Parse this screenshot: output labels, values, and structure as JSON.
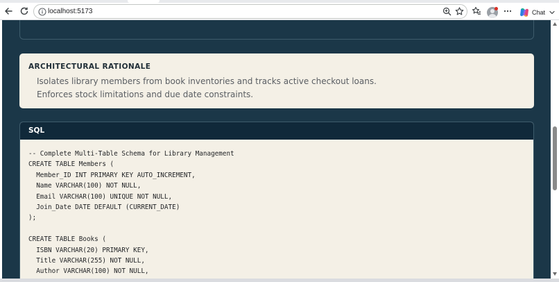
{
  "browser": {
    "url": "localhost:5173",
    "chat_label": "Chat",
    "icons": [
      "back-icon",
      "reload-icon",
      "info-icon",
      "zoom-icon",
      "star-icon",
      "favorites-icon",
      "profile-avatar",
      "more-icon",
      "copilot-icon",
      "chevron-down-icon"
    ]
  },
  "rationale": {
    "title": "ARCHITECTURAL RATIONALE",
    "lines": [
      "Isolates library members from book inventories and tracks active checkout loans.",
      "Enforces stock limitations and due date constraints."
    ]
  },
  "sql": {
    "title": "SQL",
    "lines": [
      "-- Complete Multi-Table Schema for Library Management",
      "CREATE TABLE Members (",
      "  Member_ID INT PRIMARY KEY AUTO_INCREMENT,",
      "  Name VARCHAR(100) NOT NULL,",
      "  Email VARCHAR(100) UNIQUE NOT NULL,",
      "  Join_Date DATE DEFAULT (CURRENT_DATE)",
      ");",
      "",
      "CREATE TABLE Books (",
      "  ISBN VARCHAR(20) PRIMARY KEY,",
      "  Title VARCHAR(255) NOT NULL,",
      "  Author VARCHAR(100) NOT NULL,"
    ]
  },
  "colors": {
    "page_background": "#1b3748",
    "card_background": "#f4f0e6",
    "sql_header": "#10293a"
  }
}
